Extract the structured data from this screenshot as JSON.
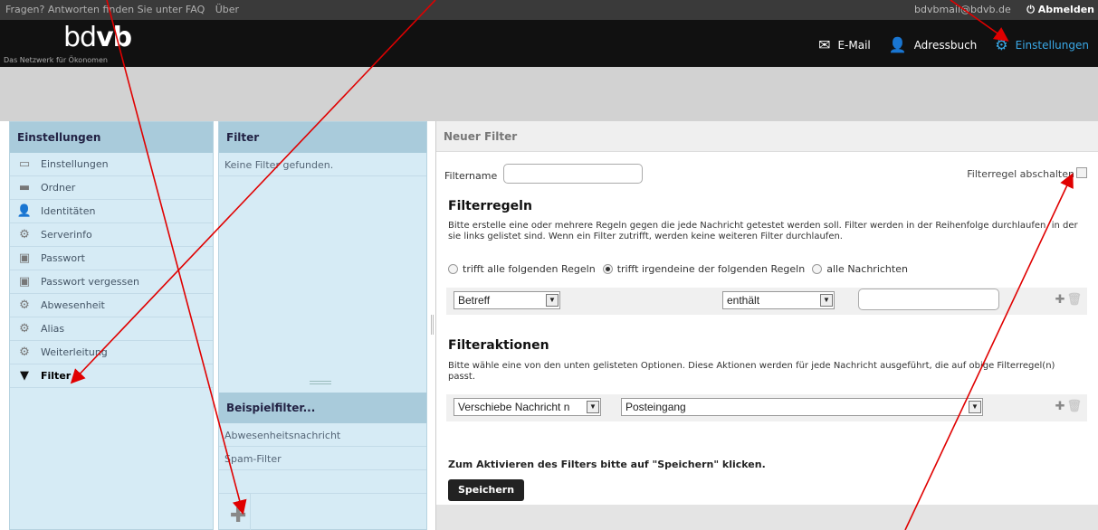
{
  "topbar": {
    "faq_text": "Fragen? Antworten finden Sie unter FAQ",
    "about": "Über",
    "email": "bdvbmail@bdvb.de",
    "logout": "Abmelden"
  },
  "header": {
    "logo_light": "bd",
    "logo_bold": "vb",
    "tagline": "Das Netzwerk für Ökonomen",
    "nav": [
      {
        "label": "E-Mail",
        "icon": "envelope-icon"
      },
      {
        "label": "Adressbuch",
        "icon": "person-icon"
      },
      {
        "label": "Einstellungen",
        "icon": "gear-icon"
      }
    ],
    "active_color": "#3aa9e8"
  },
  "settings_menu": {
    "title": "Einstellungen",
    "items": [
      {
        "label": "Einstellungen",
        "icon": "monitor-icon"
      },
      {
        "label": "Ordner",
        "icon": "folder-icon"
      },
      {
        "label": "Identitäten",
        "icon": "person-icon"
      },
      {
        "label": "Serverinfo",
        "icon": "gear-icon"
      },
      {
        "label": "Passwort",
        "icon": "password-icon"
      },
      {
        "label": "Passwort vergessen",
        "icon": "password-icon"
      },
      {
        "label": "Abwesenheit",
        "icon": "gear-icon"
      },
      {
        "label": "Alias",
        "icon": "gear-icon"
      },
      {
        "label": "Weiterleitung",
        "icon": "gear-icon"
      },
      {
        "label": "Filter",
        "icon": "funnel-icon"
      }
    ]
  },
  "filter_list": {
    "title": "Filter",
    "empty": "Keine Filter gefunden.",
    "examples_title": "Beispielfilter...",
    "examples": [
      "Abwesenheitsnachricht",
      "Spam-Filter"
    ]
  },
  "new_filter": {
    "title": "Neuer Filter",
    "name_label": "Filtername",
    "name_value": "",
    "disable_label": "Filterregel abschalten",
    "rules_title": "Filterregeln",
    "rules_desc": "Bitte erstelle eine oder mehrere Regeln gegen die jede Nachricht getestet werden soll. Filter werden in der Reihenfolge durchlaufen, in der sie links gelistet sind. Wenn ein Filter zutrifft, werden keine weiteren Filter durchlaufen.",
    "radio_all": "trifft alle folgenden Regeln",
    "radio_any": "trifft irgendeine der folgenden Regeln",
    "radio_every": "alle Nachrichten",
    "rule_field": "Betreff",
    "rule_op": "enthält",
    "rule_value": "",
    "actions_title": "Filteraktionen",
    "actions_desc": "Bitte wähle eine von den unten gelisteten Optionen. Diese Aktionen werden für jede Nachricht ausgeführt, die auf obige Filterregel(n) passt.",
    "action_type": "Verschiebe Nachricht n",
    "action_target": "Posteingang",
    "activate_hint": "Zum Aktivieren des Filters bitte auf \"Speichern\" klicken.",
    "save": "Speichern"
  }
}
